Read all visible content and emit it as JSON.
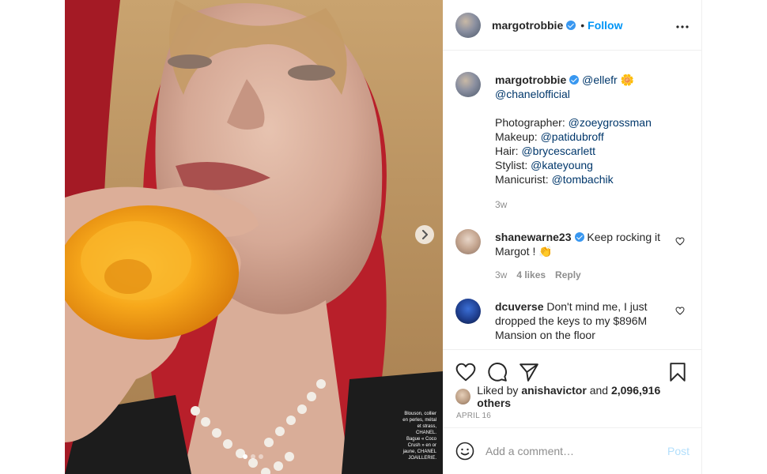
{
  "post": {
    "author": "margotrobbie",
    "follow_separator": "•",
    "follow_label": "Follow",
    "more_label": "•••",
    "photo_caption": "Blouson, collier\nen perles, métal\net strass,\nCHANEL.\nBague « Coco\nCrush » en or\njaune, CHANEL\nJOAILLERIE."
  },
  "caption": {
    "username": "margotrobbie",
    "line1_mention": "@ellefr",
    "emoji": "🌼",
    "line2_mention": "@chanelofficial",
    "credits": [
      {
        "label": "Photographer: ",
        "mention": "@zoeygrossman"
      },
      {
        "label": "Makeup: ",
        "mention": "@patidubroff"
      },
      {
        "label": "Hair: ",
        "mention": "@brycescarlett"
      },
      {
        "label": "Stylist: ",
        "mention": "@kateyoung"
      },
      {
        "label": "Manicurist: ",
        "mention": "@tombachik"
      }
    ],
    "age": "3w"
  },
  "comments": [
    {
      "username": "shanewarne23",
      "verified": true,
      "text": "Keep rocking it Margot ! 👏",
      "age": "3w",
      "likes": "4 likes",
      "reply": "Reply"
    },
    {
      "username": "dcuverse",
      "verified": false,
      "text": "Don't mind me, I just dropped the keys to my $896M Mansion on the floor"
    }
  ],
  "likes": {
    "prefix": "Liked by ",
    "user": "anishavictor",
    "middle": " and ",
    "count": "2,096,916 others"
  },
  "date": "APRIL 16",
  "add_comment": {
    "placeholder": "Add a comment…",
    "post_label": "Post"
  },
  "colors": {
    "accent": "#0095f6",
    "mention": "#00376b",
    "muted": "#8e8e8e",
    "post_disabled": "#b2dffc"
  }
}
